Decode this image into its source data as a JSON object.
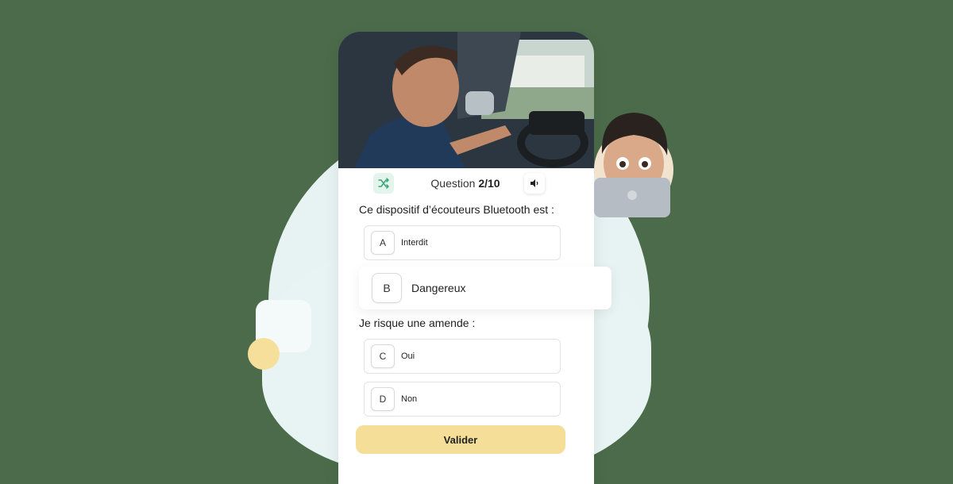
{
  "quiz": {
    "question_label": "Question",
    "question_progress": "2/10",
    "prompt1": "Ce dispositif d’écouteurs Bluetooth est :",
    "answers1": [
      {
        "letter": "A",
        "text": "Interdit"
      },
      {
        "letter": "B",
        "text": "Dangereux"
      }
    ],
    "prompt2": "Je risque une amende :",
    "answers2": [
      {
        "letter": "C",
        "text": "Oui"
      },
      {
        "letter": "D",
        "text": "Non"
      }
    ],
    "validate_label": "Valider"
  },
  "icons": {
    "shuffle": "shuffle-icon",
    "sound": "speaker-icon"
  },
  "colors": {
    "background": "#4b6b4a",
    "accent_yellow": "#f4de98",
    "mint": "#e3f4ec"
  }
}
